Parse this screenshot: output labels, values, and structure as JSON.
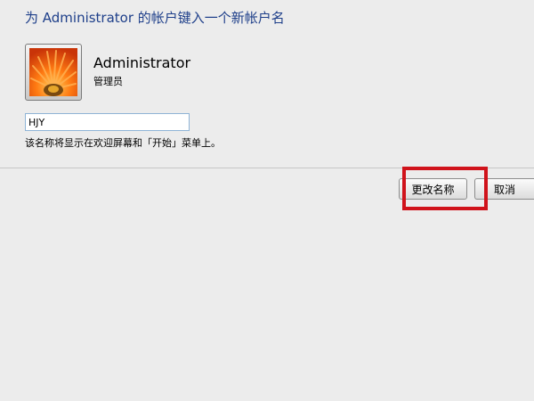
{
  "dialog": {
    "title": "为 Administrator 的帐户键入一个新帐户名"
  },
  "account": {
    "avatar_icon": "flower-picture-icon",
    "name": "Administrator",
    "role": "管理员"
  },
  "rename_form": {
    "new_name_value": "HJY",
    "hint": "该名称将显示在欢迎屏幕和「开始」菜单上。"
  },
  "buttons": {
    "rename_label": "更改名称",
    "cancel_label": "取消"
  },
  "annotation": {
    "highlight_color": "#d0131b"
  }
}
